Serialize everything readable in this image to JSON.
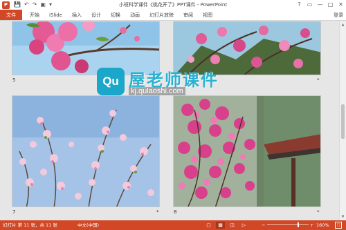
{
  "app": {
    "icon_letter": "P",
    "title": "小班科学课件《桃花开了》PPT课件 - PowerPoint",
    "accent_color": "#d24726"
  },
  "qat": {
    "save_icon": "save-icon",
    "undo_icon": "undo-icon",
    "redo_icon": "redo-icon",
    "start_icon": "start-presentation-icon"
  },
  "window_controls": {
    "help": "?",
    "restore_ribbon": "▭",
    "minimize": "—",
    "maximize": "□",
    "close": "✕"
  },
  "ribbon": {
    "file_label": "文件",
    "tabs": [
      "开始",
      "iSlide",
      "插入",
      "设计",
      "切换",
      "动画",
      "幻灯片放映",
      "审阅",
      "视图"
    ],
    "login_label": "登录"
  },
  "slides": [
    {
      "number": "5",
      "star": "*"
    },
    {
      "number": "",
      "star": "*"
    },
    {
      "number": "7",
      "star": "*"
    },
    {
      "number": "8",
      "star": "*"
    }
  ],
  "watermark": {
    "badge": "Qu",
    "main_text": "屋老师课件",
    "url": "kj.qulaoshi.com"
  },
  "status": {
    "slide_info": "幻灯片 第 11 张，共 11 张",
    "language": "中文(中国)",
    "zoom": "160%",
    "zoom_value_percent": 160
  }
}
